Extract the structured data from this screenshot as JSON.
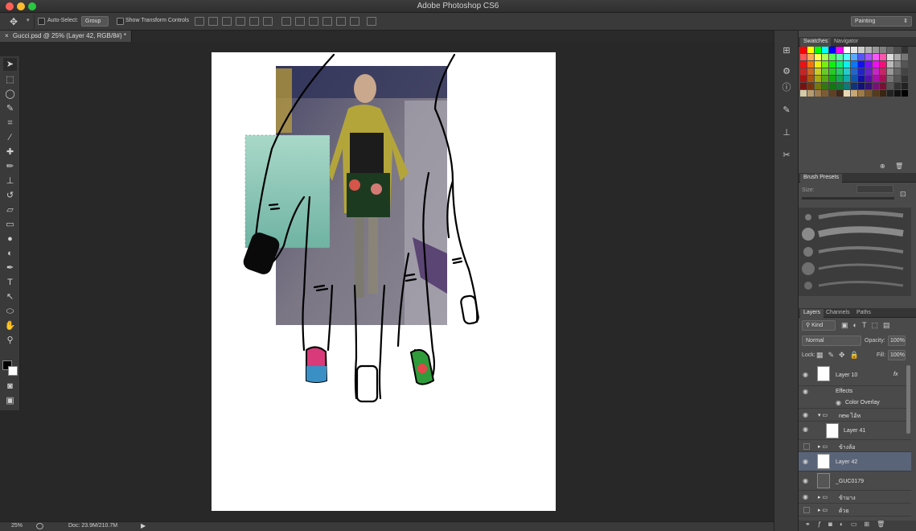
{
  "app": {
    "title": "Adobe Photoshop CS6",
    "workspace": "Painting"
  },
  "options": {
    "auto_select_label": "Auto-Select:",
    "auto_select_value": "Group",
    "transform_label": "Show Transform Controls"
  },
  "document": {
    "tab_title": "Gucci.psd @ 25% (Layer 42, RGB/8#) *",
    "close_glyph": "×"
  },
  "status": {
    "zoom": "25%",
    "doc_size": "Doc: 23.9M/210.7M"
  },
  "panels": {
    "swatches_tab": "Swatches",
    "navigator_tab": "Navigator",
    "brush_presets_title": "Brush Presets",
    "brush_size_label": "Size:",
    "layers_tabs": [
      "Layers",
      "Channels",
      "Paths"
    ],
    "kind_label": "Kind",
    "blend_mode": "Normal",
    "opacity_label": "Opacity:",
    "opacity_value": "100%",
    "lock_label": "Lock:",
    "fill_label": "Fill:",
    "fill_value": "100%"
  },
  "layers": [
    {
      "name": "Layer 10",
      "fx": "fx"
    },
    {
      "name": "Effects"
    },
    {
      "name": "Color Overlay"
    },
    {
      "name": "new ไอ้ห"
    },
    {
      "name": "Layer 41"
    },
    {
      "name": "ข้างล้อ"
    },
    {
      "name": "Layer 42"
    },
    {
      "name": "_GUC0179"
    },
    {
      "name": "ข้ามาง"
    },
    {
      "name": "ด้วย"
    }
  ],
  "colors": {
    "accent_selected": "#5a6478",
    "panel_bg": "#4a4a4a",
    "canvas": "#ffffff",
    "workspace": "#282828"
  }
}
